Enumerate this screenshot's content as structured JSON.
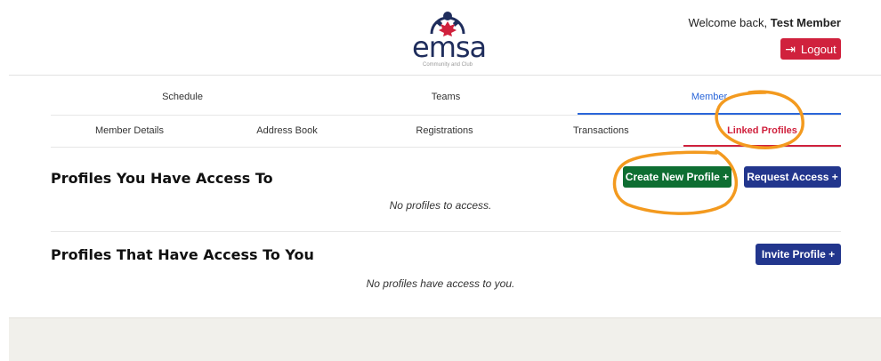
{
  "header": {
    "logo_word": "emsa",
    "logo_tagline": "Community and Club",
    "welcome_prefix": "Welcome back,",
    "user_name": "Test Member",
    "logout_icon": "logout-icon",
    "logout_label": "Logout"
  },
  "main_nav": [
    {
      "label": "Schedule",
      "active": false
    },
    {
      "label": "Teams",
      "active": false
    },
    {
      "label": "Member",
      "active": true
    }
  ],
  "sub_nav": [
    {
      "label": "Member Details",
      "active": false
    },
    {
      "label": "Address Book",
      "active": false
    },
    {
      "label": "Registrations",
      "active": false
    },
    {
      "label": "Transactions",
      "active": false
    },
    {
      "label": "Linked Profiles",
      "active": true
    }
  ],
  "sections": {
    "access_to": {
      "title": "Profiles You Have Access To",
      "create_label": "Create New Profile +",
      "request_label": "Request Access +",
      "empty": "No profiles to access."
    },
    "access_by": {
      "title": "Profiles That Have Access To You",
      "invite_label": "Invite Profile +",
      "empty": "No profiles have access to you."
    }
  },
  "colors": {
    "accent_red": "#d0213d",
    "accent_blue": "#2a66d9",
    "button_green": "#0e6e32",
    "button_navy": "#22368d",
    "annotation_orange": "#f39a1f"
  }
}
